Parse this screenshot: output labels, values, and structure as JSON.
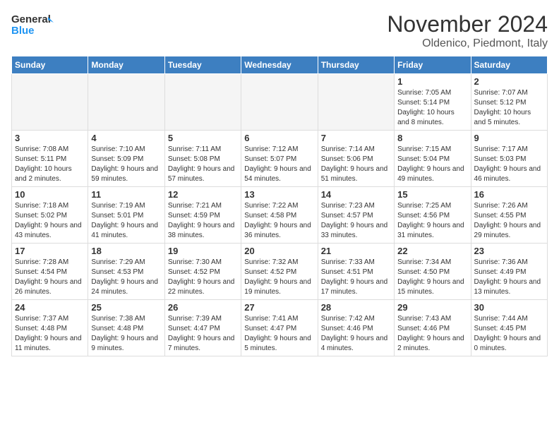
{
  "logo": {
    "line1": "General",
    "line2": "Blue"
  },
  "header": {
    "month": "November 2024",
    "location": "Oldenico, Piedmont, Italy"
  },
  "weekdays": [
    "Sunday",
    "Monday",
    "Tuesday",
    "Wednesday",
    "Thursday",
    "Friday",
    "Saturday"
  ],
  "weeks": [
    [
      {
        "day": "",
        "info": ""
      },
      {
        "day": "",
        "info": ""
      },
      {
        "day": "",
        "info": ""
      },
      {
        "day": "",
        "info": ""
      },
      {
        "day": "",
        "info": ""
      },
      {
        "day": "1",
        "info": "Sunrise: 7:05 AM\nSunset: 5:14 PM\nDaylight: 10 hours and 8 minutes."
      },
      {
        "day": "2",
        "info": "Sunrise: 7:07 AM\nSunset: 5:12 PM\nDaylight: 10 hours and 5 minutes."
      }
    ],
    [
      {
        "day": "3",
        "info": "Sunrise: 7:08 AM\nSunset: 5:11 PM\nDaylight: 10 hours and 2 minutes."
      },
      {
        "day": "4",
        "info": "Sunrise: 7:10 AM\nSunset: 5:09 PM\nDaylight: 9 hours and 59 minutes."
      },
      {
        "day": "5",
        "info": "Sunrise: 7:11 AM\nSunset: 5:08 PM\nDaylight: 9 hours and 57 minutes."
      },
      {
        "day": "6",
        "info": "Sunrise: 7:12 AM\nSunset: 5:07 PM\nDaylight: 9 hours and 54 minutes."
      },
      {
        "day": "7",
        "info": "Sunrise: 7:14 AM\nSunset: 5:06 PM\nDaylight: 9 hours and 51 minutes."
      },
      {
        "day": "8",
        "info": "Sunrise: 7:15 AM\nSunset: 5:04 PM\nDaylight: 9 hours and 49 minutes."
      },
      {
        "day": "9",
        "info": "Sunrise: 7:17 AM\nSunset: 5:03 PM\nDaylight: 9 hours and 46 minutes."
      }
    ],
    [
      {
        "day": "10",
        "info": "Sunrise: 7:18 AM\nSunset: 5:02 PM\nDaylight: 9 hours and 43 minutes."
      },
      {
        "day": "11",
        "info": "Sunrise: 7:19 AM\nSunset: 5:01 PM\nDaylight: 9 hours and 41 minutes."
      },
      {
        "day": "12",
        "info": "Sunrise: 7:21 AM\nSunset: 4:59 PM\nDaylight: 9 hours and 38 minutes."
      },
      {
        "day": "13",
        "info": "Sunrise: 7:22 AM\nSunset: 4:58 PM\nDaylight: 9 hours and 36 minutes."
      },
      {
        "day": "14",
        "info": "Sunrise: 7:23 AM\nSunset: 4:57 PM\nDaylight: 9 hours and 33 minutes."
      },
      {
        "day": "15",
        "info": "Sunrise: 7:25 AM\nSunset: 4:56 PM\nDaylight: 9 hours and 31 minutes."
      },
      {
        "day": "16",
        "info": "Sunrise: 7:26 AM\nSunset: 4:55 PM\nDaylight: 9 hours and 29 minutes."
      }
    ],
    [
      {
        "day": "17",
        "info": "Sunrise: 7:28 AM\nSunset: 4:54 PM\nDaylight: 9 hours and 26 minutes."
      },
      {
        "day": "18",
        "info": "Sunrise: 7:29 AM\nSunset: 4:53 PM\nDaylight: 9 hours and 24 minutes."
      },
      {
        "day": "19",
        "info": "Sunrise: 7:30 AM\nSunset: 4:52 PM\nDaylight: 9 hours and 22 minutes."
      },
      {
        "day": "20",
        "info": "Sunrise: 7:32 AM\nSunset: 4:52 PM\nDaylight: 9 hours and 19 minutes."
      },
      {
        "day": "21",
        "info": "Sunrise: 7:33 AM\nSunset: 4:51 PM\nDaylight: 9 hours and 17 minutes."
      },
      {
        "day": "22",
        "info": "Sunrise: 7:34 AM\nSunset: 4:50 PM\nDaylight: 9 hours and 15 minutes."
      },
      {
        "day": "23",
        "info": "Sunrise: 7:36 AM\nSunset: 4:49 PM\nDaylight: 9 hours and 13 minutes."
      }
    ],
    [
      {
        "day": "24",
        "info": "Sunrise: 7:37 AM\nSunset: 4:48 PM\nDaylight: 9 hours and 11 minutes."
      },
      {
        "day": "25",
        "info": "Sunrise: 7:38 AM\nSunset: 4:48 PM\nDaylight: 9 hours and 9 minutes."
      },
      {
        "day": "26",
        "info": "Sunrise: 7:39 AM\nSunset: 4:47 PM\nDaylight: 9 hours and 7 minutes."
      },
      {
        "day": "27",
        "info": "Sunrise: 7:41 AM\nSunset: 4:47 PM\nDaylight: 9 hours and 5 minutes."
      },
      {
        "day": "28",
        "info": "Sunrise: 7:42 AM\nSunset: 4:46 PM\nDaylight: 9 hours and 4 minutes."
      },
      {
        "day": "29",
        "info": "Sunrise: 7:43 AM\nSunset: 4:46 PM\nDaylight: 9 hours and 2 minutes."
      },
      {
        "day": "30",
        "info": "Sunrise: 7:44 AM\nSunset: 4:45 PM\nDaylight: 9 hours and 0 minutes."
      }
    ]
  ]
}
